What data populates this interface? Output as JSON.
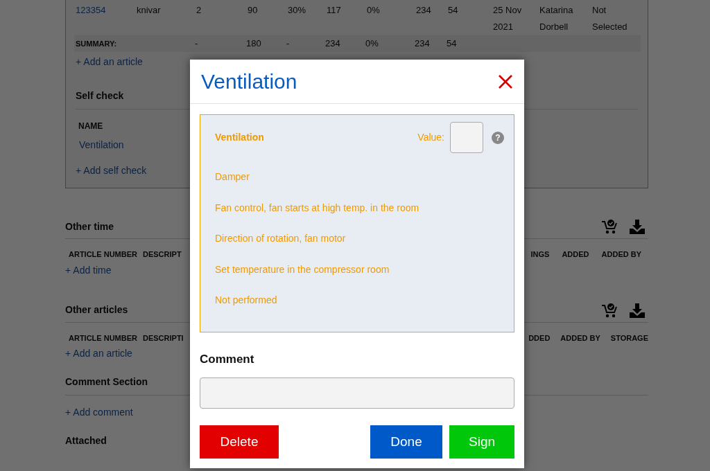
{
  "articles_table": {
    "rows": [
      {
        "cells": [
          "123354",
          "knivar",
          "2",
          "90",
          "30%",
          "117",
          "0%",
          "234",
          "54",
          "25 Nov 2021",
          "Katarina Dorbell",
          "Not Selected"
        ]
      }
    ],
    "summary": {
      "label": "SUMMARY:",
      "cells": [
        "",
        "-",
        "180",
        "-",
        "234",
        "0%",
        "234",
        "54"
      ]
    },
    "add_link": "+ Add an article"
  },
  "self_check": {
    "title": "Self check",
    "column": "NAME",
    "items": [
      "Ventilation"
    ],
    "add_link": "+ Add self check"
  },
  "sections": [
    {
      "title": "Other time",
      "icons": true,
      "columns_left": [
        "ARTICLE NUMBER",
        "DESCRIPT"
      ],
      "columns_right": [
        "INGS",
        "ADDED",
        "ADDED BY"
      ],
      "add_link": "+ Add time"
    },
    {
      "title": "Other articles",
      "icons": true,
      "columns_left": [
        "ARTICLE NUMBER",
        "DESCRIPTI"
      ],
      "columns_right": [
        "DDED",
        "ADDED BY",
        "STORAGE"
      ],
      "add_link": "+ Add an article"
    },
    {
      "title": "Comment Section",
      "icons": false,
      "add_link": "+ Add comment"
    },
    {
      "title": "Attached",
      "icons": false
    }
  ],
  "modal": {
    "title": "Ventilation",
    "check": {
      "name": "Ventilation",
      "value_label": "Value:",
      "help": "?",
      "options": [
        "Damper",
        "Fan control, fan starts at high temp. in the room",
        "Direction of rotation, fan motor",
        "Set temperature in the compressor room",
        "Not performed"
      ]
    },
    "comment_label": "Comment",
    "buttons": [
      {
        "label": "Delete",
        "kind": "danger"
      },
      {
        "label": "Done",
        "kind": "primary"
      },
      {
        "label": "Sign",
        "kind": "success"
      }
    ]
  }
}
